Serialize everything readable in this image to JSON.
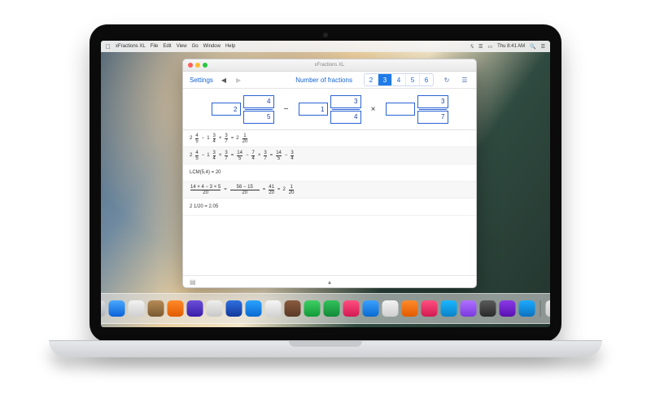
{
  "osx": {
    "app_name": "xFractions XL",
    "menus": [
      "File",
      "Edit",
      "View",
      "Go",
      "Window",
      "Help"
    ],
    "clock": "Thu 8:41 AM"
  },
  "window": {
    "title": "xFractions XL",
    "settings_label": "Settings",
    "nof_label": "Number of fractions",
    "nof_options": [
      "2",
      "3",
      "4",
      "5",
      "6"
    ],
    "nof_selected": "3"
  },
  "input": {
    "t1_whole": "2",
    "t1_num": "4",
    "t1_den": "5",
    "op1": "−",
    "t2_whole": "1",
    "t2_num": "3",
    "t2_den": "4",
    "op2": "×",
    "t3_whole": "",
    "t3_num": "3",
    "t3_den": "7"
  },
  "work": {
    "line1": {
      "a_w": "2",
      "a_n": "4",
      "a_d": "5",
      "b_w": "1",
      "b_n": "3",
      "b_d": "4",
      "c_n": "3",
      "c_d": "7",
      "r_w": "2",
      "r_n": "1",
      "r_d": "20"
    },
    "line2": {
      "a_w": "2",
      "a_n": "4",
      "a_d": "5",
      "b_w": "1",
      "b_n": "3",
      "b_d": "4",
      "c_n": "3",
      "c_d": "7",
      "s1_n": "14",
      "s1_d": "5",
      "s2_n": "7",
      "s2_d": "4",
      "s3_n": "3",
      "s3_d": "7",
      "s4_n": "14",
      "s4_d": "5",
      "s5_n": "3",
      "s5_d": "4"
    },
    "lcm": "LCM(5,4) = 20",
    "line3": {
      "big_n": "14 × 4 − 3 × 5",
      "big_d": "20",
      "m1_n": "56 − 15",
      "m1_d": "20",
      "m2_n": "41",
      "m2_d": "20",
      "r_w": "2",
      "r_n": "1",
      "r_d": "20"
    },
    "dec": "2 1/20 = 2.05"
  },
  "dock_colors": [
    "linear-gradient(#d9dde2,#aeb4bc)",
    "linear-gradient(#4aa8ff,#0a62d8)",
    "linear-gradient(#f2f2f2,#cfcfcf)",
    "linear-gradient(#b58b55,#7a5a33)",
    "linear-gradient(#ff8a2a,#e25b00)",
    "linear-gradient(#6b4fd8,#3a1ea8)",
    "linear-gradient(#efefef,#c8c8c8)",
    "linear-gradient(#2f6fe0,#12399a)",
    "linear-gradient(#2aa3ff,#0a6ad0)",
    "linear-gradient(#f5f5f5,#d2d2d2)",
    "linear-gradient(#8a5a3e,#5a3a26)",
    "linear-gradient(#3dcf63,#139a3a)",
    "linear-gradient(#33c15a,#128a38)",
    "linear-gradient(#ff4e7e,#d21a52)",
    "linear-gradient(#3aa0ff,#0a6ad0)",
    "linear-gradient(#f2f2f2,#cfcfcf)",
    "linear-gradient(#ff8a2a,#e25b00)",
    "linear-gradient(#ff4e7e,#d21a52)",
    "linear-gradient(#1ab6ff,#0a82c8)",
    "linear-gradient(#b070ff,#7a3ae0)",
    "linear-gradient(#5a5a5a,#2a2a2a)",
    "linear-gradient(#8a3ae8,#5a10b0)",
    "linear-gradient(#1caaff,#0a72c0)",
    "linear-gradient(#e9e9e9,#cfcfcf)"
  ]
}
